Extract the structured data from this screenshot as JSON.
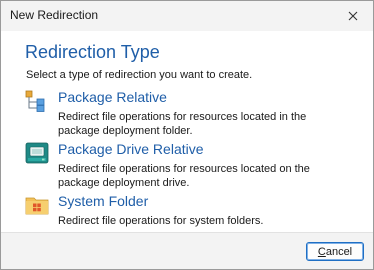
{
  "window": {
    "title": "New Redirection",
    "close_icon": "close-icon"
  },
  "main": {
    "heading": "Redirection Type",
    "subtitle": "Select a type of redirection you want to create.",
    "options": [
      {
        "title": "Package Relative",
        "description": "Redirect file operations for resources located in the package deployment folder.",
        "icon": "package-tree-icon"
      },
      {
        "title": "Package Drive Relative",
        "description": "Redirect file operations for resources located on the package deployment drive.",
        "icon": "drive-icon"
      },
      {
        "title": "System Folder",
        "description": "Redirect file operations for system folders.",
        "icon": "system-folder-icon"
      }
    ]
  },
  "footer": {
    "cancel_mnemonic": "C",
    "cancel_rest": "ancel"
  },
  "colors": {
    "accent": "#1f5ea8",
    "titlebar": "#f3f3f3",
    "footer": "#f3f3f3"
  }
}
